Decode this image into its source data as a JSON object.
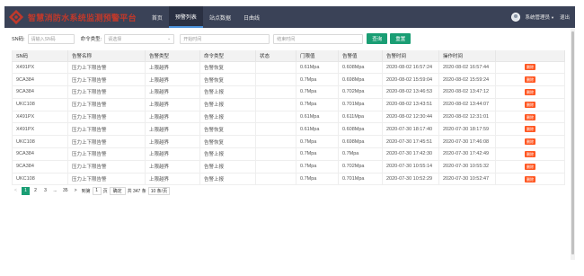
{
  "header": {
    "title": "智慧消防水系统监测预警平台",
    "nav": [
      {
        "label": "首页",
        "active": false
      },
      {
        "label": "预警列表",
        "active": true
      },
      {
        "label": "站点数据",
        "active": false
      },
      {
        "label": "日曲线",
        "active": false
      }
    ],
    "user": "系统管理员",
    "logout": "退出",
    "icons": {
      "logo": "logo-icon",
      "avatar": "user-avatar",
      "caret": "caret-down-icon"
    }
  },
  "filter": {
    "sn_label": "SN码:",
    "sn_placeholder": "请输入SN码",
    "cmd_label": "命令类型:",
    "cmd_value": "请选择",
    "start_placeholder": "开始时间",
    "end_placeholder": "结束时间",
    "query_label": "查询",
    "reset_label": "重置"
  },
  "table": {
    "columns": [
      "SN码",
      "告警名称",
      "告警类型",
      "命令类型",
      "状态",
      "门限值",
      "告警值",
      "告警时间",
      "操作时间",
      ""
    ],
    "delete_label": "删除",
    "rows": [
      [
        "X491PX",
        "压力上下限告警",
        "上限越界",
        "告警恢复",
        "",
        "0.61Mpa",
        "0.608Mpa",
        "2020-08-02 16:57:24",
        "2020-08-02 16:57:44"
      ],
      [
        "9CA384",
        "压力上下限告警",
        "上限越界",
        "告警恢复",
        "",
        "0.7Mpa",
        "0.698Mpa",
        "2020-08-02 15:59:04",
        "2020-08-02 15:59:24"
      ],
      [
        "9CA384",
        "压力上下限告警",
        "上限越界",
        "告警上报",
        "",
        "0.7Mpa",
        "0.702Mpa",
        "2020-08-02 13:46:53",
        "2020-08-02 13:47:12"
      ],
      [
        "UKC108",
        "压力上下限告警",
        "上限越界",
        "告警上报",
        "",
        "0.7Mpa",
        "0.701Mpa",
        "2020-08-02 13:43:51",
        "2020-08-02 13:44:07"
      ],
      [
        "X491PX",
        "压力上下限告警",
        "上限越界",
        "告警上报",
        "",
        "0.61Mpa",
        "0.611Mpa",
        "2020-08-02 12:30:44",
        "2020-08-02 12:31:01"
      ],
      [
        "X491PX",
        "压力上下限告警",
        "上限越界",
        "告警恢复",
        "",
        "0.61Mpa",
        "0.608Mpa",
        "2020-07-30 18:17:40",
        "2020-07-30 18:17:59"
      ],
      [
        "UKC108",
        "压力上下限告警",
        "上限越界",
        "告警恢复",
        "",
        "0.7Mpa",
        "0.698Mpa",
        "2020-07-30 17:45:51",
        "2020-07-30 17:46:08"
      ],
      [
        "9CA384",
        "压力上下限告警",
        "上限越界",
        "告警上报",
        "",
        "0.7Mpa",
        "0.7Mpa",
        "2020-07-30 17:42:30",
        "2020-07-30 17:42:49"
      ],
      [
        "9CA384",
        "压力上下限告警",
        "上限越界",
        "告警上报",
        "",
        "0.7Mpa",
        "0.702Mpa",
        "2020-07-30 10:55:14",
        "2020-07-30 10:55:32"
      ],
      [
        "UKC108",
        "压力上下限告警",
        "上限越界",
        "告警上报",
        "",
        "0.7Mpa",
        "0.701Mpa",
        "2020-07-30 10:52:29",
        "2020-07-30 10:52:47"
      ]
    ]
  },
  "pager": {
    "prev": "<",
    "pages": [
      "1",
      "2",
      "3",
      "...",
      "35"
    ],
    "next": ">",
    "goto_label": "到第",
    "goto_value": "1",
    "page_unit": "页",
    "confirm": "确定",
    "total": "共 347 条",
    "page_size": "10 条/页"
  },
  "colors": {
    "header": "#3a4257",
    "accent": "#1a9e74",
    "danger": "#ff5722",
    "title": "#c0392b"
  }
}
